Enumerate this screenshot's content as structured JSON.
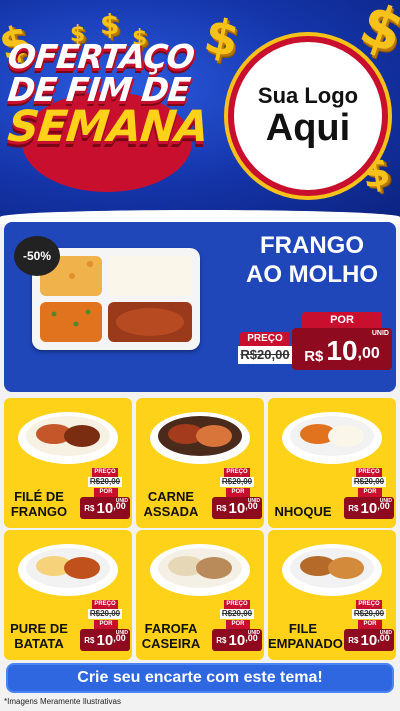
{
  "header": {
    "title_line1": "OFERTAÇO",
    "title_line2": "DE FIM DE",
    "title_line3": "SEMANA",
    "coin_symbol": "$",
    "logo_line1": "Sua Logo",
    "logo_line2": "Aqui"
  },
  "featured": {
    "discount": "-50%",
    "name_line1": "FRANGO",
    "name_line2": "AO MOLHO",
    "preco_label": "PREÇO",
    "old_price": "R$20,00",
    "por_label": "POR",
    "unid_label": "UNID",
    "currency": "R$",
    "new_price_int": "10",
    "new_price_cents": ",00"
  },
  "products": [
    {
      "line1": "FILÉ DE",
      "line2": "FRANGO",
      "preco_label": "PREÇO",
      "old_price": "R$20,00",
      "por_label": "POR",
      "unid_label": "UNID",
      "currency": "R$",
      "price_int": "10",
      "price_cents": ",00"
    },
    {
      "line1": "CARNE",
      "line2": "ASSADA",
      "preco_label": "PREÇO",
      "old_price": "R$20,00",
      "por_label": "POR",
      "unid_label": "UNID",
      "currency": "R$",
      "price_int": "10",
      "price_cents": ",00"
    },
    {
      "line1": "NHOQUE",
      "line2": "",
      "preco_label": "PREÇO",
      "old_price": "R$20,00",
      "por_label": "POR",
      "unid_label": "UNID",
      "currency": "R$",
      "price_int": "10",
      "price_cents": ",00"
    },
    {
      "line1": "PURE DE",
      "line2": "BATATA",
      "preco_label": "PREÇO",
      "old_price": "R$20,00",
      "por_label": "POR",
      "unid_label": "UNID",
      "currency": "R$",
      "price_int": "10",
      "price_cents": ",00"
    },
    {
      "line1": "FAROFA",
      "line2": "CASEIRA",
      "preco_label": "PREÇO",
      "old_price": "R$20,00",
      "por_label": "POR",
      "unid_label": "UNID",
      "currency": "R$",
      "price_int": "10",
      "price_cents": ",00"
    },
    {
      "line1": "FILE",
      "line2": "EMPANADO",
      "preco_label": "PREÇO",
      "old_price": "R$20,00",
      "por_label": "POR",
      "unid_label": "UNID",
      "currency": "R$",
      "price_int": "10",
      "price_cents": ",00"
    }
  ],
  "cta": {
    "label": "Crie seu encarte com este tema!"
  },
  "footer": {
    "disclaimer": "*Imagens Meramente Ilustrativas"
  },
  "colors": {
    "header_blue": "#1434a8",
    "card_yellow": "#ffd21a",
    "price_red": "#c8102e",
    "price_dark": "#8d0a1f",
    "cta_blue": "#2f67e0"
  }
}
